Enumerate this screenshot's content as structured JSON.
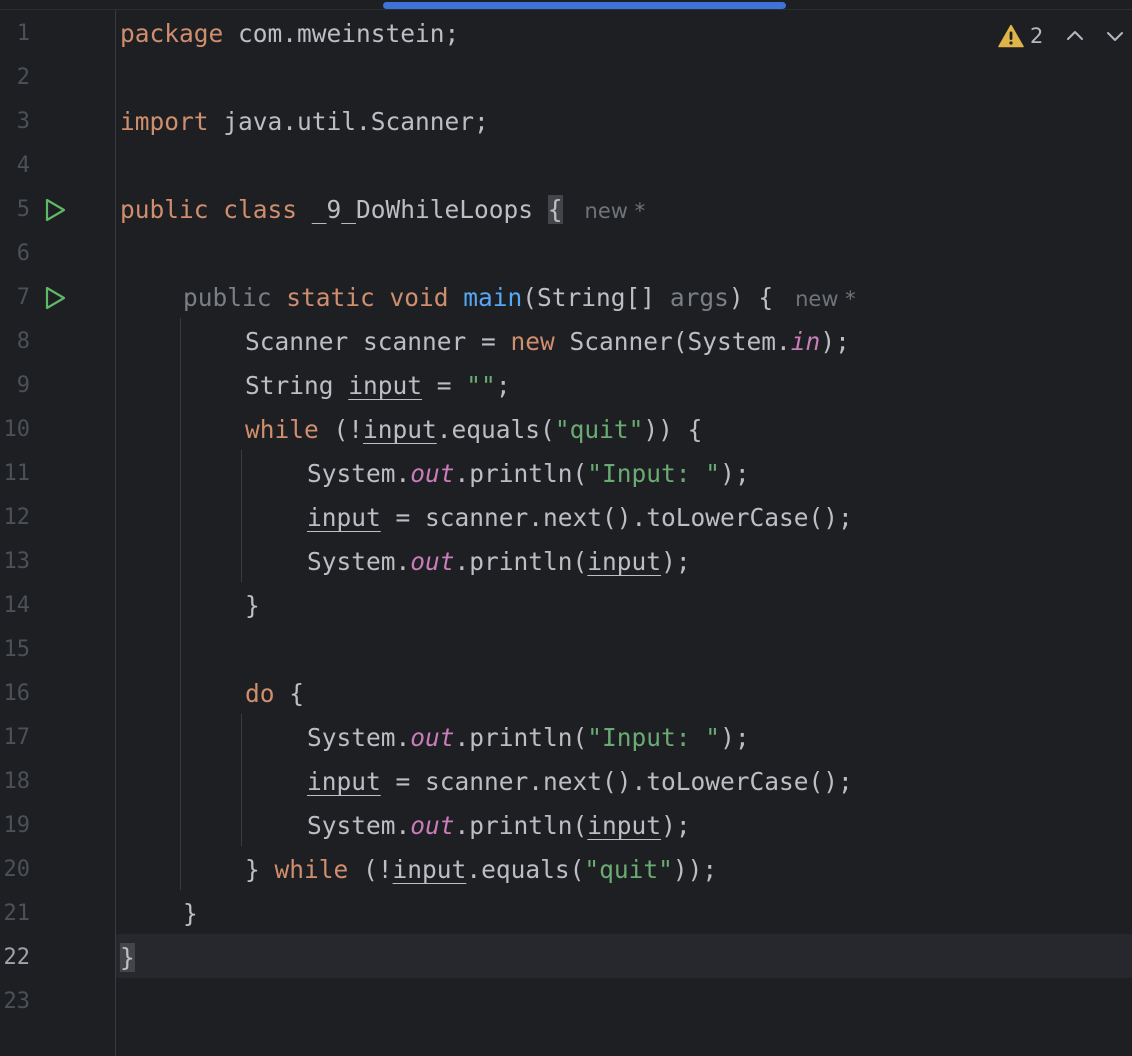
{
  "scroll_indicator": {
    "color": "#3d73d8"
  },
  "inspections": {
    "warning_count": "2",
    "icon": "warning-triangle-icon",
    "nav": [
      "chevron-up-icon",
      "chevron-down-icon"
    ]
  },
  "hints": {
    "class_hint": "new *",
    "method_hint": "new *"
  },
  "code": {
    "line_numbers": [
      "1",
      "2",
      "3",
      "4",
      "5",
      "6",
      "7",
      "8",
      "9",
      "10",
      "11",
      "12",
      "13",
      "14",
      "15",
      "16",
      "17",
      "18",
      "19",
      "20",
      "21",
      "22",
      "23"
    ],
    "current_line": "22",
    "l1": {
      "kw": "package",
      "rest": " com.mweinstein;"
    },
    "l3": {
      "kw": "import",
      "rest": " java.util.Scanner;"
    },
    "l5": {
      "kw": "public class",
      "name": " _9_DoWhileLoops ",
      "brace": "{"
    },
    "l7": {
      "mod": "public",
      "kw": " static void ",
      "fn": "main",
      "sig": "(String[] ",
      "param": "args",
      "tail": ") {"
    },
    "l8": {
      "a": "Scanner scanner = ",
      "kw": "new",
      "b": " Scanner(System.",
      "stat": "in",
      "c": ");"
    },
    "l9": {
      "a": "String ",
      "var": "input",
      "b": " = ",
      "str": "\"\"",
      "c": ";"
    },
    "l10": {
      "kw": "while",
      "a": " (!",
      "var": "input",
      "b": ".equals(",
      "str": "\"quit\"",
      "c": ")) {"
    },
    "l11": {
      "a": "System.",
      "stat": "out",
      "b": ".println(",
      "str": "\"Input: \"",
      "c": ");"
    },
    "l12": {
      "var": "input",
      "a": " = scanner.next().toLowerCase();"
    },
    "l13": {
      "a": "System.",
      "stat": "out",
      "b": ".println(",
      "var": "input",
      "c": ");"
    },
    "l14": {
      "a": "}"
    },
    "l16": {
      "kw": "do",
      "a": " {"
    },
    "l17": {
      "a": "System.",
      "stat": "out",
      "b": ".println(",
      "str": "\"Input: \"",
      "c": ");"
    },
    "l18": {
      "var": "input",
      "a": " = scanner.next().toLowerCase();"
    },
    "l19": {
      "a": "System.",
      "stat": "out",
      "b": ".println(",
      "var": "input",
      "c": ");"
    },
    "l20": {
      "a": "} ",
      "kw": "while",
      "b": " (!",
      "var": "input",
      "c": ".equals(",
      "str": "\"quit\"",
      "d": "));"
    },
    "l21": {
      "a": "}"
    },
    "l22": {
      "a": "}"
    }
  },
  "colors": {
    "background": "#1e1f22",
    "keyword": "#cf8e6d",
    "function": "#56a8f5",
    "string": "#6aab73",
    "static_field": "#c77dbb",
    "default_text": "#bcbec4",
    "run_icon": "#5fb865",
    "warning": "#e0b44a"
  }
}
